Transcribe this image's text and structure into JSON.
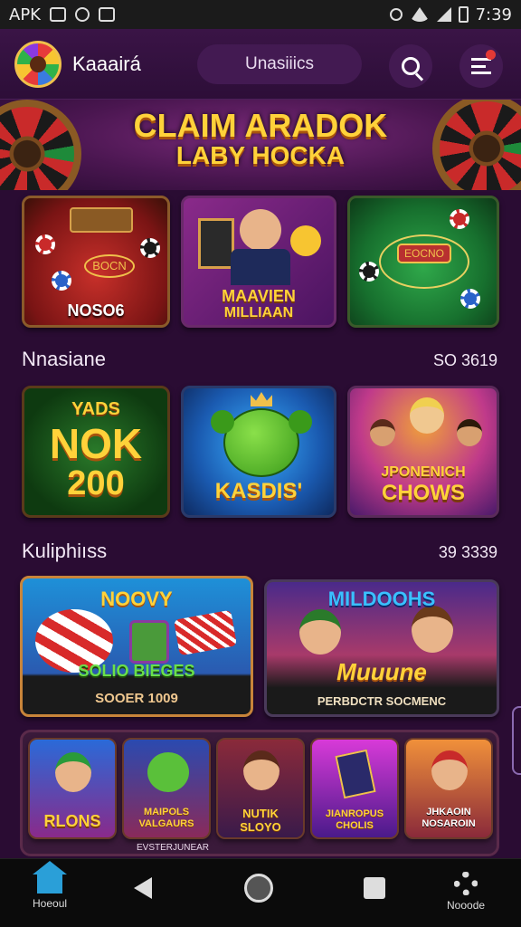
{
  "status_bar": {
    "left_text": "APK",
    "time": "7:39"
  },
  "header": {
    "app_name": "Kaaairá",
    "search_label": "Unasiiics",
    "search_icon": "search-icon",
    "menu_icon": "menu-icon"
  },
  "banner": {
    "line1": "CLAIM ARADOK",
    "line2": "LABY HOCKA"
  },
  "featured": [
    {
      "label": "NOSO6",
      "sign": "BOCN"
    },
    {
      "label_line1": "MAAVIEN",
      "label_line2": "MILLIAAN"
    },
    {
      "sign": "EOCNO"
    }
  ],
  "section1": {
    "title": "Nnasiane",
    "count": "SO 3619",
    "tiles": [
      {
        "line1": "YADS",
        "line2": "NOK",
        "line3": "200"
      },
      {
        "label": "KASDIS'"
      },
      {
        "line1": "JPONENICH",
        "line2": "CHOWS"
      }
    ]
  },
  "section2": {
    "title": "Kuliphiıss",
    "count": "39 3339",
    "cards": [
      {
        "top": "NOOVY",
        "mid": "SOLIO BIEGES",
        "bottom": "SOOER 1009"
      },
      {
        "top": "MILDOOHS",
        "mid": "Muuune",
        "bottom": "PERBDCTR SOCMENC"
      }
    ]
  },
  "strip": {
    "tiles": [
      "RLONS",
      "MAIPOLS VALGAURS",
      "NUTIK SLOYO",
      "JIANROPUS CHOLIS",
      "JHKAOIN NOSAROIN"
    ],
    "caption": "EVSTERJUNEAR"
  },
  "nav": {
    "home_label": "Hoeoul",
    "settings_label": "Nooode"
  },
  "colors": {
    "accent": "#ffd23a",
    "background": "#2a0c33",
    "nav_home": "#2a9fd8"
  }
}
